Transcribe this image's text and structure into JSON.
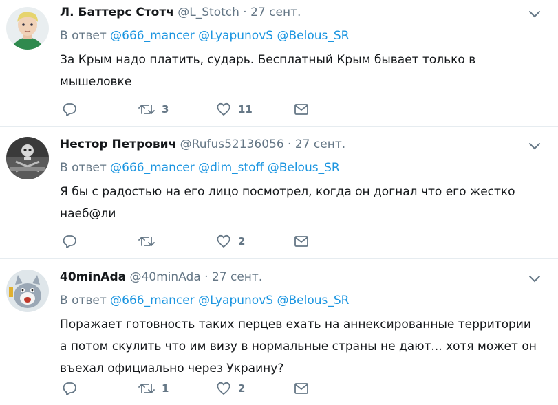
{
  "tweets": [
    {
      "name": "Л. Баттерс Стотч",
      "handle": "@L_Stotch",
      "sep": "·",
      "time": "27 сент.",
      "reply_prefix": "В ответ",
      "mentions": [
        "@666_mancer",
        "@LyapunovS",
        "@Belous_SR"
      ],
      "text": "За Крым надо платить, сударь. Бесплатный Крым бывает только в мышеловке",
      "retweets": "3",
      "likes": "11"
    },
    {
      "name": "Нестор Петрович",
      "handle": "@Rufus52136056",
      "sep": "·",
      "time": "27 сент.",
      "reply_prefix": "В ответ",
      "mentions": [
        "@666_mancer",
        "@dim_stoff",
        "@Belous_SR"
      ],
      "text": "Я бы с радостью на его лицо посмотрел, когда он догнал что его жестко наеб@ли",
      "retweets": "",
      "likes": "2"
    },
    {
      "name": "40minAda",
      "handle": "@40minAda",
      "sep": "·",
      "time": "27 сент.",
      "reply_prefix": "В ответ",
      "mentions": [
        "@666_mancer",
        "@LyapunovS",
        "@Belous_SR"
      ],
      "text": "Поражает готовность таких перцев ехать на аннексированные территории а потом скулить что им визу в нормальные страны не дают... хотя может он въехал официально через Украину?",
      "retweets": "1",
      "likes": "2"
    }
  ],
  "icons": {
    "reply": "reply-icon",
    "retweet": "retweet-icon",
    "like": "heart-icon",
    "dm": "envelope-icon",
    "more": "chevron-down-icon"
  },
  "colors": {
    "link": "#1b95e0",
    "secondary": "#657786",
    "text": "#14171a",
    "divider": "#e6ecf0"
  }
}
